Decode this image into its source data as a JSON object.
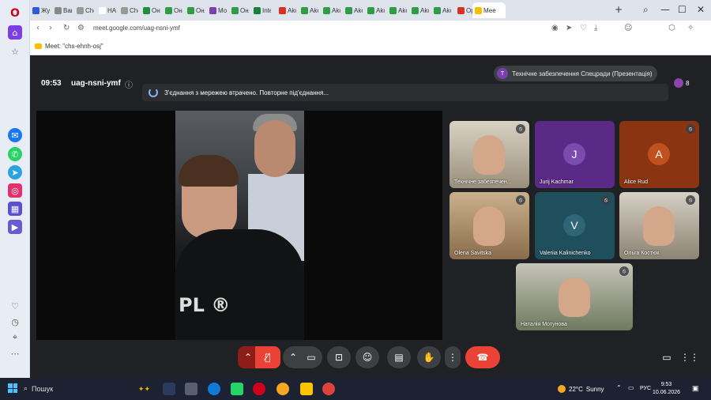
{
  "browser": {
    "tabs": [
      {
        "label": "Жур",
        "fav": "#2b5bd7"
      },
      {
        "label": "Ваш",
        "fav": "#888"
      },
      {
        "label": "Che",
        "fav": "#999"
      },
      {
        "label": "HAI",
        "fav": "#ffffff"
      },
      {
        "label": "Che",
        "fav": "#999"
      },
      {
        "label": "Онг",
        "fav": "#1e8e3e"
      },
      {
        "label": "Онл",
        "fav": "#2e9d44"
      },
      {
        "label": "Онл",
        "fav": "#2e9d44"
      },
      {
        "label": "Мо",
        "fav": "#7b3fb0"
      },
      {
        "label": "Онл",
        "fav": "#2e9d44"
      },
      {
        "label": "Inte",
        "fav": "#1a7f37"
      },
      {
        "label": "Ako",
        "fav": "#d93025"
      },
      {
        "label": "Ako",
        "fav": "#2e9d44"
      },
      {
        "label": "Ako",
        "fav": "#2e9d44"
      },
      {
        "label": "Ako",
        "fav": "#2e9d44"
      },
      {
        "label": "Ako",
        "fav": "#2e9d44"
      },
      {
        "label": "Ako",
        "fav": "#2e9d44"
      },
      {
        "label": "Ako",
        "fav": "#2e9d44"
      },
      {
        "label": "Ako",
        "fav": "#2e9d44"
      },
      {
        "label": "Opt",
        "fav": "#d93025"
      },
      {
        "label": "Мее",
        "fav": "#fbbc04",
        "active": true
      }
    ],
    "new_tab": "+",
    "url": "meet.google.com/uag-nsni-ymf",
    "meet_tab_label": "Meet: \"chs-ehnh-osj\""
  },
  "meet": {
    "time": "09:53",
    "code": "uag-nsni-ymf",
    "presenter": "Технічне забезпечення Спецради (Презентація)",
    "presenter_initial": "T",
    "connection_message": "З'єднання з мережею втрачено. Повторне під'єднання...",
    "people_count": "8",
    "participants": [
      {
        "name": "Технічне забезпечен...",
        "initial": "",
        "video": true,
        "muted": true
      },
      {
        "name": "Jurij Kachmar",
        "initial": "J",
        "video": false,
        "muted": false
      },
      {
        "name": "Alice Rud",
        "initial": "A",
        "video": false,
        "muted": true
      },
      {
        "name": "Olena Savitska",
        "initial": "",
        "video": true,
        "muted": true
      },
      {
        "name": "Valeriia Kalinichenko",
        "initial": "V",
        "video": false,
        "muted": true
      },
      {
        "name": "Ольга Костюк",
        "initial": "",
        "video": true,
        "muted": true
      },
      {
        "name": "Наталія Мотунова",
        "initial": "",
        "video": true,
        "muted": true
      }
    ],
    "main_logo_text": "PL ®"
  },
  "taskbar": {
    "search_placeholder": "Пошук",
    "weather_temp": "22°C",
    "weather_desc": "Sunny",
    "lang": "РУС",
    "clock_time": "9:53",
    "clock_date": "10.06.2026"
  }
}
